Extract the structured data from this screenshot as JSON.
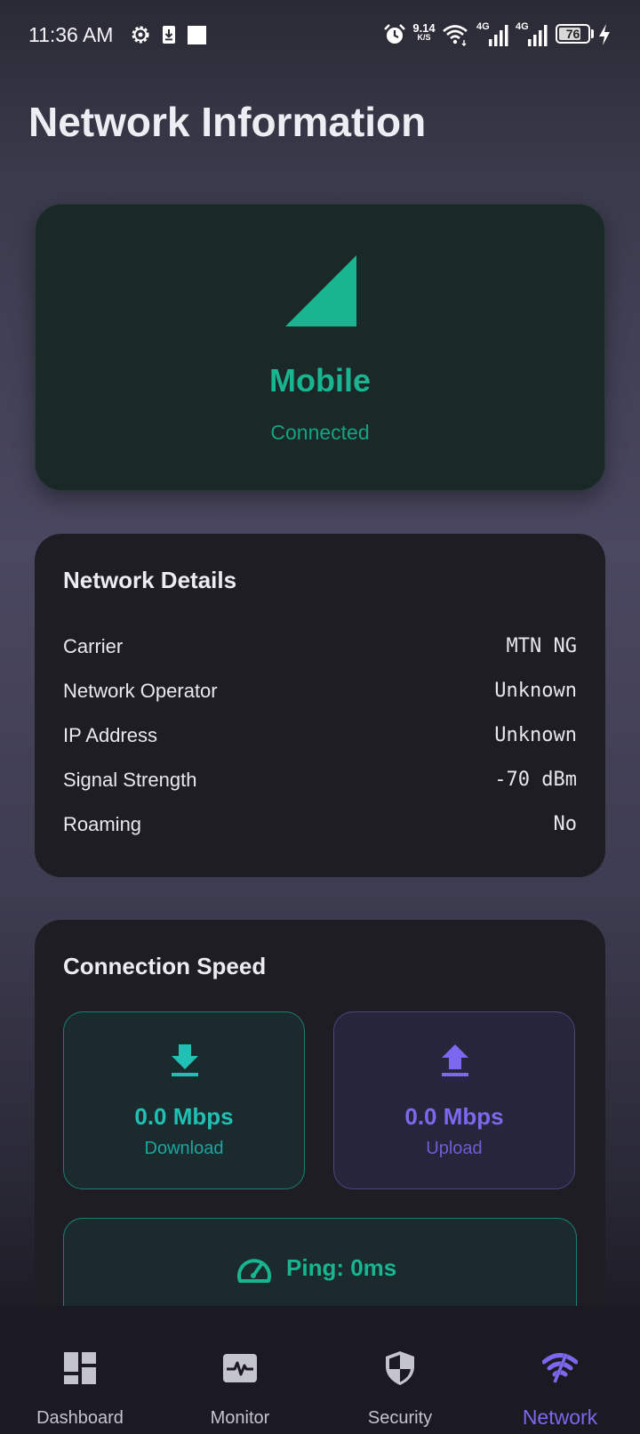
{
  "status_bar": {
    "time": "11:36 AM",
    "net_speed_value": "9.14",
    "net_speed_unit": "K/S",
    "sim1_type": "4G",
    "sim2_type": "4G",
    "battery_level": "76",
    "icons": [
      "settings-icon",
      "download-notification-icon",
      "notification-square-icon",
      "alarm-icon",
      "wifi-icon",
      "signal-icon",
      "battery-icon",
      "charging-icon"
    ]
  },
  "page": {
    "title": "Network Information"
  },
  "connection": {
    "type": "Mobile",
    "status": "Connected",
    "icon": "cellular-signal-icon"
  },
  "details": {
    "title": "Network Details",
    "rows": [
      {
        "label": "Carrier",
        "value": "MTN NG"
      },
      {
        "label": "Network Operator",
        "value": "Unknown"
      },
      {
        "label": "IP Address",
        "value": "Unknown"
      },
      {
        "label": "Signal Strength",
        "value": "-70 dBm"
      },
      {
        "label": "Roaming",
        "value": "No"
      }
    ]
  },
  "speed": {
    "title": "Connection Speed",
    "download": {
      "value": "0.0 Mbps",
      "label": "Download"
    },
    "upload": {
      "value": "0.0 Mbps",
      "label": "Upload"
    },
    "ping": "Ping: 0ms"
  },
  "nav": {
    "items": [
      {
        "label": "Dashboard",
        "icon": "dashboard-icon"
      },
      {
        "label": "Monitor",
        "icon": "monitor-icon"
      },
      {
        "label": "Security",
        "icon": "security-shield-icon"
      },
      {
        "label": "Network",
        "icon": "network-wifi-icon"
      }
    ],
    "active": "Network"
  },
  "colors": {
    "accent_green": "#19b590",
    "accent_teal": "#20c0b4",
    "accent_purple": "#7b68ee",
    "card_bg": "#1e1d24",
    "hero_bg": "#1b2828"
  }
}
